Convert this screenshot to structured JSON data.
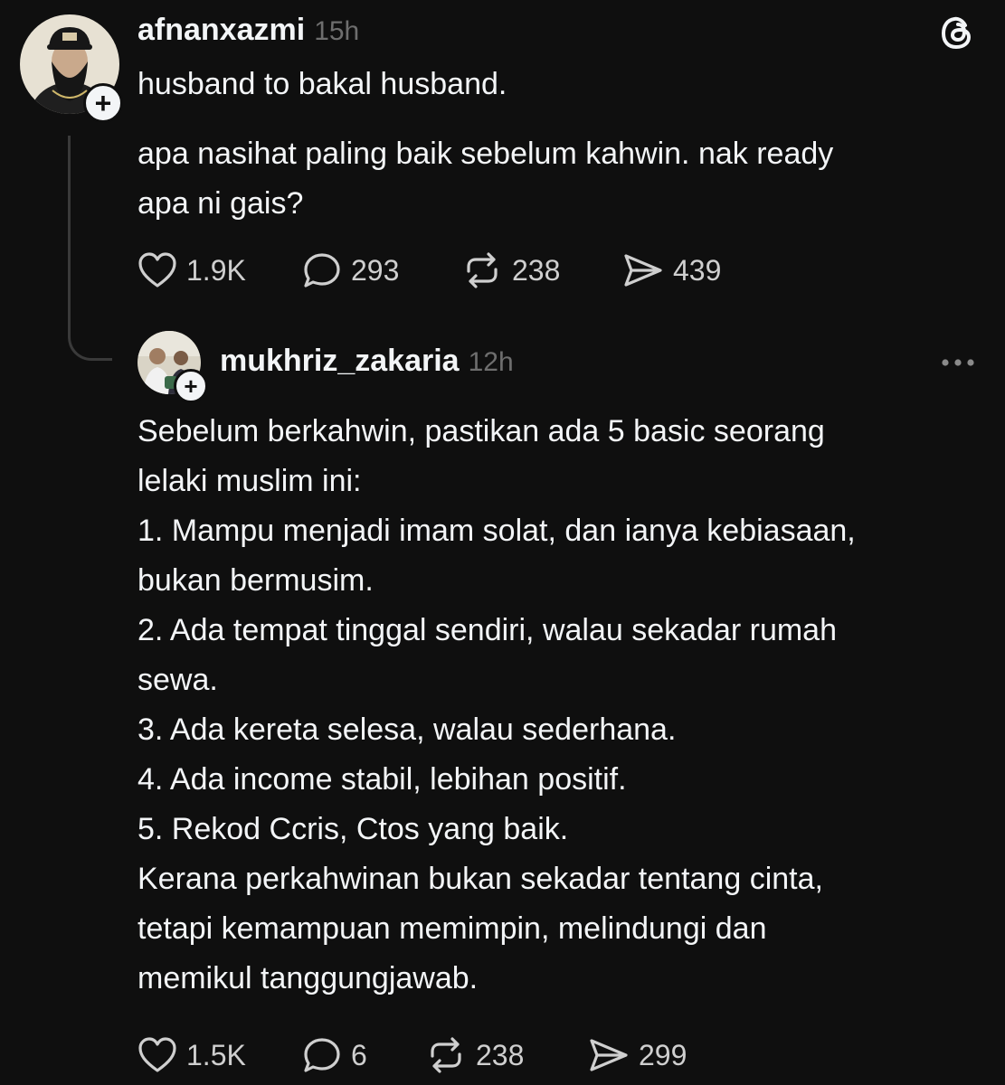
{
  "app": {
    "logo_icon": "threads-logo-icon"
  },
  "post": {
    "username": "afnanxazmi",
    "time": "15h",
    "paragraphs": [
      [
        "husband to bakal husband."
      ],
      [
        "apa nasihat paling baik sebelum kahwin. nak ready",
        "apa ni gais?"
      ]
    ],
    "actions": {
      "likes": "1.9K",
      "replies": "293",
      "reposts": "238",
      "shares": "439"
    }
  },
  "reply": {
    "username": "mukhriz_zakaria",
    "time": "12h",
    "more_icon": "more-horizontal-icon",
    "lines": [
      "Sebelum berkahwin, pastikan ada 5 basic seorang",
      "lelaki muslim ini:",
      "1. Mampu menjadi imam solat, dan ianya kebiasaan,",
      "bukan bermusim.",
      "2. Ada tempat tinggal sendiri, walau sekadar rumah",
      "sewa.",
      "3. Ada kereta selesa, walau sederhana.",
      "4. Ada income stabil, lebihan positif.",
      "5. Rekod Ccris, Ctos yang baik.",
      "Kerana perkahwinan bukan sekadar tentang cinta,",
      "tetapi kemampuan memimpin, melindungi dan",
      "memikul tanggungjawab."
    ],
    "actions": {
      "likes": "1.5K",
      "replies": "6",
      "reposts": "238",
      "shares": "299"
    }
  },
  "colors": {
    "background": "#0f0f0f",
    "text": "#f3f5f7",
    "muted": "#6e6e6e",
    "thread_line": "#3a3a3a"
  }
}
